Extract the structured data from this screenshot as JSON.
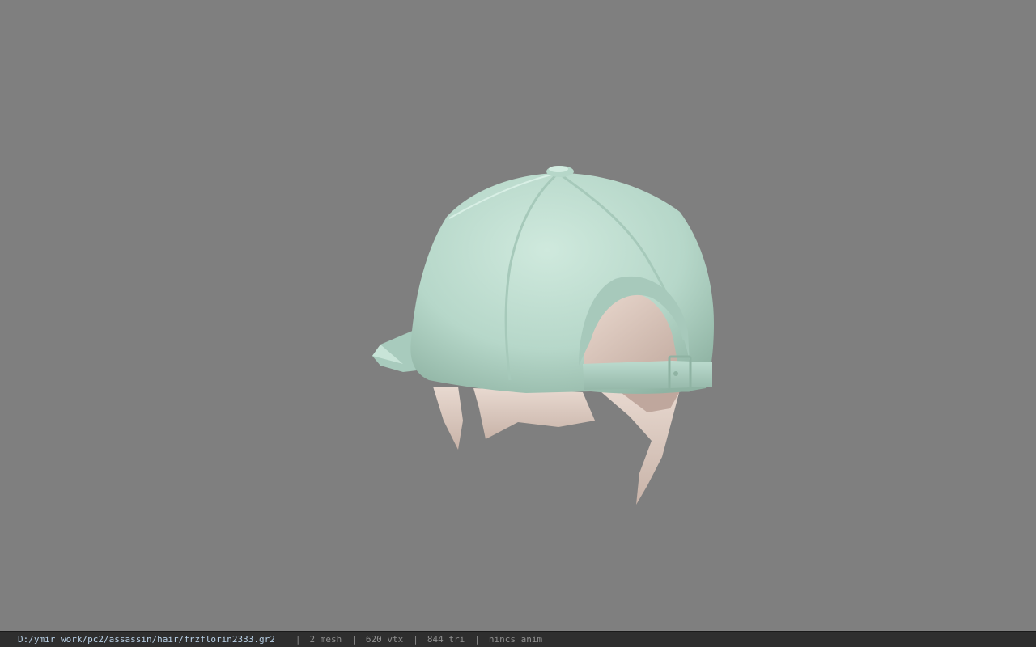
{
  "viewport": {
    "background": "#7f7f7f",
    "model": {
      "description_icon": "baseball-cap-hair-model",
      "cap_color": "#b9d9cc",
      "hair_color": "#d9c7be"
    }
  },
  "statusbar": {
    "file_path": "D:/ymir work/pc2/assassin/hair/frzflorin2333.gr2",
    "separator": "|",
    "mesh": "2 mesh",
    "vtx": "620 vtx",
    "tri": "844 tri",
    "anim": "nincs anim"
  }
}
